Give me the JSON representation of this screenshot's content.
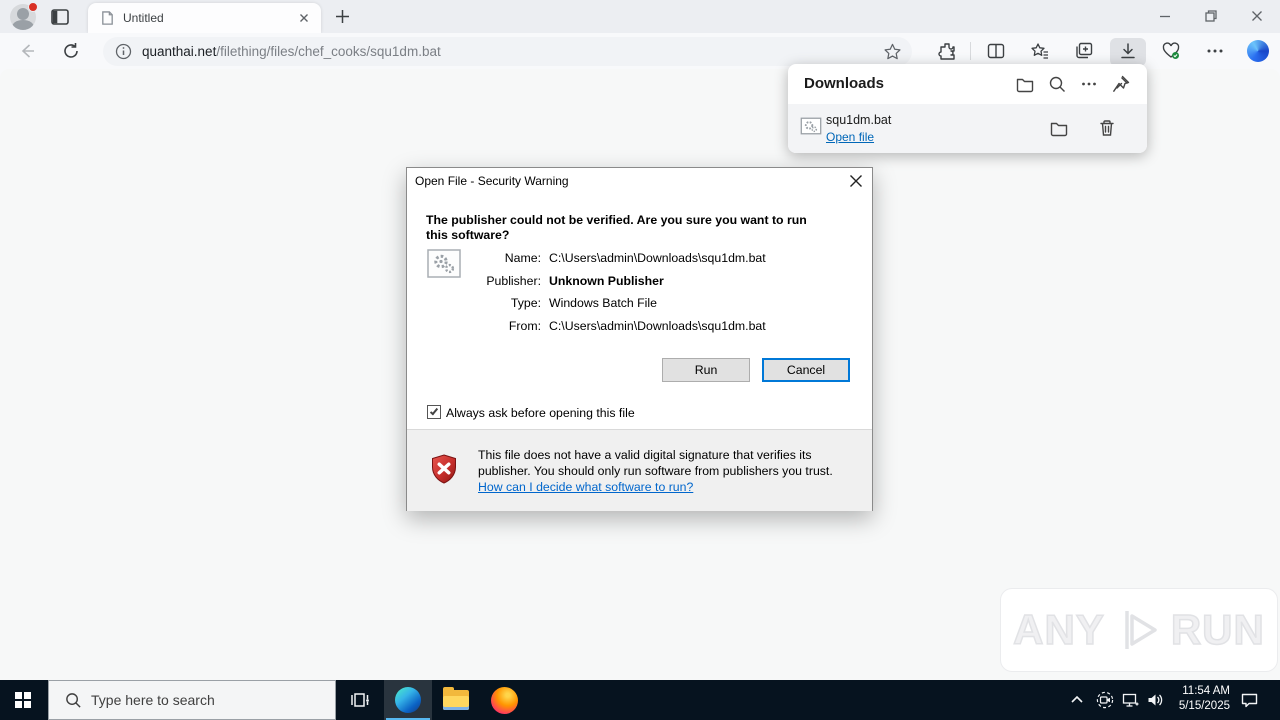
{
  "browser": {
    "tab": {
      "title": "Untitled"
    },
    "toolbar": {
      "url_domain": "quanthai.net",
      "url_path": "/filething/files/chef_cooks/squ1dm.bat"
    }
  },
  "downloads_panel": {
    "title": "Downloads",
    "item": {
      "filename": "squ1dm.bat",
      "open_file_label": "Open file"
    }
  },
  "dialog": {
    "title": "Open File - Security Warning",
    "header": "The publisher could not be verified.  Are you sure you want to run this software?",
    "fields": [
      {
        "label": "Name:",
        "value": "C:\\Users\\admin\\Downloads\\squ1dm.bat"
      },
      {
        "label": "Publisher:",
        "value": "Unknown Publisher"
      },
      {
        "label": "Type:",
        "value": "Windows Batch File"
      },
      {
        "label": "From:",
        "value": "C:\\Users\\admin\\Downloads\\squ1dm.bat"
      }
    ],
    "run_label": "Run",
    "cancel_label": "Cancel",
    "checkbox_label": "Always ask before opening this file",
    "checkbox_checked": true,
    "warning_text": "This file does not have a valid digital signature that verifies its publisher.  You should only run software from publishers you trust.",
    "warning_link": "How can I decide what software to run?"
  },
  "watermark": {
    "left": "ANY",
    "right": "RUN"
  },
  "taskbar": {
    "search_placeholder": "Type here to search",
    "time": "11:54 AM",
    "date": "5/15/2025"
  },
  "colors": {
    "accent_blue": "#0078d7",
    "link_blue": "#0067b8",
    "taskbar_bg": "#06131f",
    "warning_red": "#d13438"
  }
}
